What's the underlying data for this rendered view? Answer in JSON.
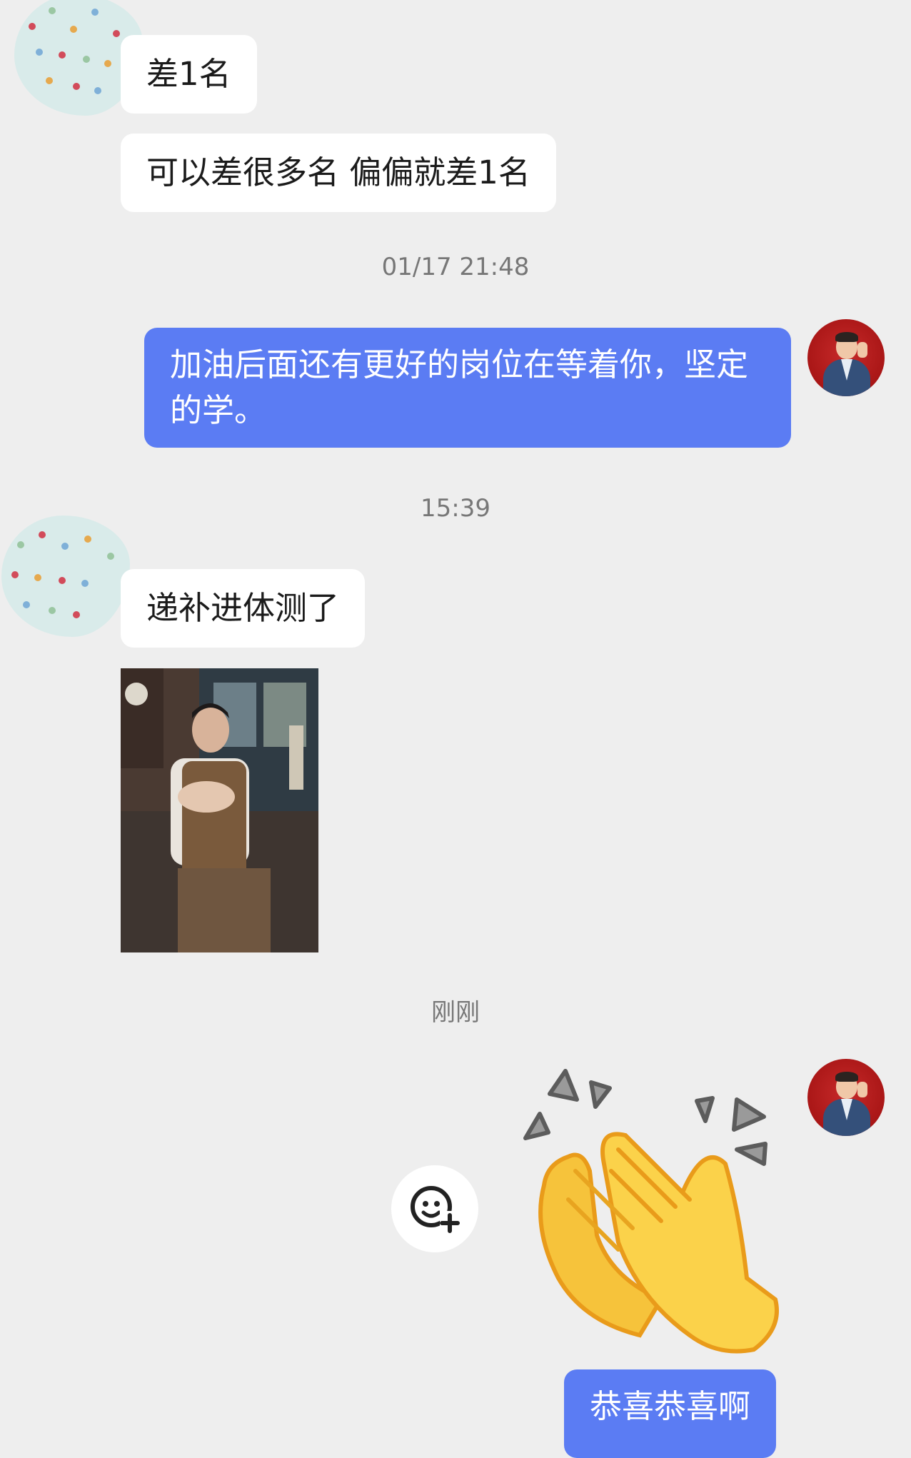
{
  "messages": {
    "m1": "差1名",
    "m2": "可以差很多名 偏偏就差1名",
    "ts1": "01/17 21:48",
    "m3": "加油后面还有更好的岗位在等着你，坚定的学。",
    "ts2": "15:39",
    "m4": "递补进体测了",
    "ts3": "刚刚",
    "m5": "恭喜恭喜啊"
  },
  "icons": {
    "emoji_add": "emoji-add-icon",
    "clap": "clapping-hands-emoji"
  },
  "colors": {
    "background": "#eeeeee",
    "outgoing_bubble": "#5b7cf3",
    "incoming_bubble": "#ffffff",
    "timestamp": "#777777"
  }
}
